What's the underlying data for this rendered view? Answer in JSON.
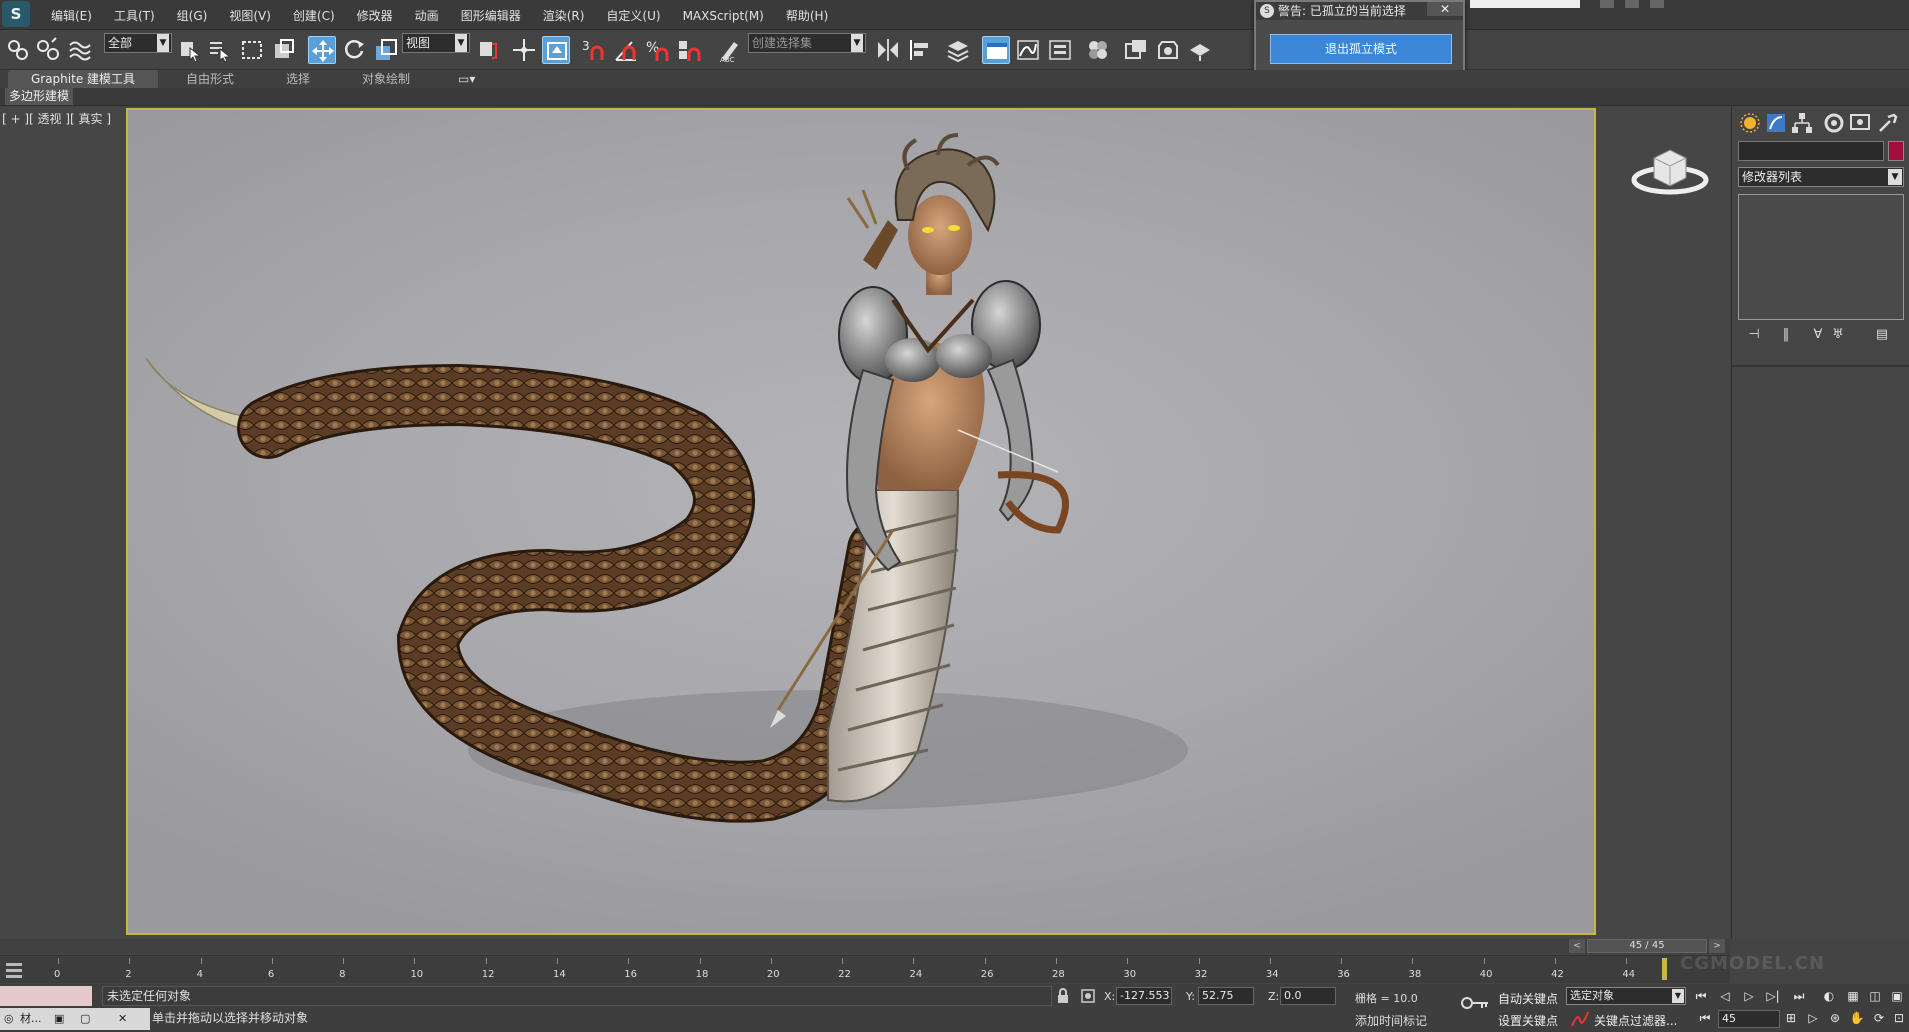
{
  "menu": {
    "logo": "S",
    "items": [
      "编辑(E)",
      "工具(T)",
      "组(G)",
      "视图(V)",
      "创建(C)",
      "修改器",
      "动画",
      "图形编辑器",
      "渲染(R)",
      "自定义(U)",
      "MAXScript(M)",
      "帮助(H)"
    ]
  },
  "toolbar": {
    "filter_dropdown": "全部",
    "refcoord_dropdown": "视图",
    "selection_set_dropdown": "创建选择集"
  },
  "ribbon": {
    "tabs": [
      "Graphite 建模工具",
      "自由形式",
      "选择",
      "对象绘制"
    ],
    "sub_label": "多边形建模"
  },
  "viewport": {
    "label": "[ + ][ 透视 ][ 真实 ]"
  },
  "isolate_dialog": {
    "title": "警告: 已孤立的当前选择",
    "close": "✕",
    "button": "退出孤立模式"
  },
  "command_panel": {
    "modifier_list": "修改器列表"
  },
  "time_slider": {
    "position": "45 / 45",
    "prev": "<",
    "next": ">"
  },
  "trackbar": {
    "ticks": [
      "0",
      "2",
      "4",
      "6",
      "8",
      "10",
      "12",
      "14",
      "16",
      "18",
      "20",
      "22",
      "24",
      "26",
      "28",
      "30",
      "32",
      "34",
      "36",
      "38",
      "40",
      "42",
      "44"
    ],
    "current_frame": 45,
    "max_frame": 45
  },
  "status": {
    "line1": "未选定任何对象",
    "line2": "单击并拖动以选择并移动对象",
    "x_label": "X:",
    "x_value": "-127.553",
    "y_label": "Y:",
    "y_value": "52.75",
    "z_label": "Z:",
    "z_value": "0.0",
    "grid": "栅格 = 10.0",
    "add_time_tag": "添加时间标记",
    "auto_key": "自动关键点",
    "set_key": "设置关键点",
    "selected_object": "选定对象",
    "key_filters": "关键点过滤器...",
    "frame": "45",
    "taskbar_item": "材...",
    "taskbar_close": "✕"
  },
  "watermark": "CGMODEL.CN",
  "colors": {
    "accent": "#3b86d6",
    "viewport_border": "#c8b64a",
    "panel_bg": "#444444",
    "swatch": "#a0103a"
  }
}
